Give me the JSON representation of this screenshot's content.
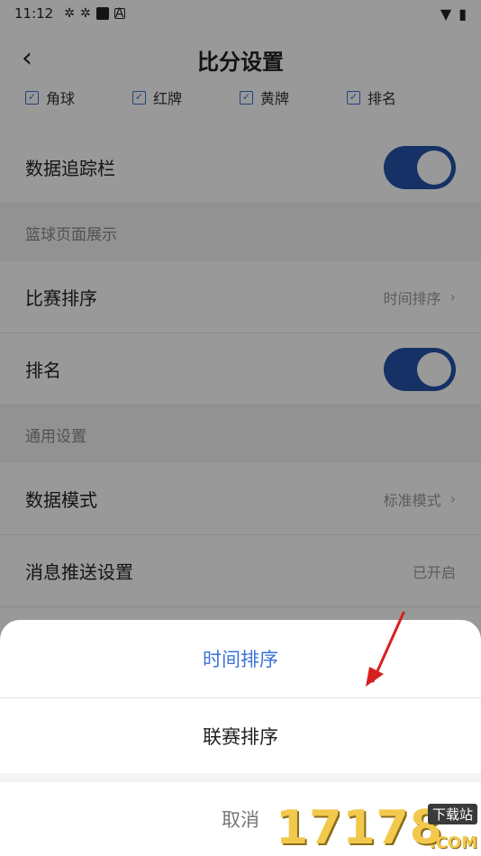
{
  "status_bar": {
    "time": "11:12"
  },
  "header": {
    "title": "比分设置",
    "back_icon": "chevron-left-icon"
  },
  "checkboxes": [
    {
      "label": "角球"
    },
    {
      "label": "红牌"
    },
    {
      "label": "黄牌"
    },
    {
      "label": "排名"
    }
  ],
  "rows": {
    "tracker": {
      "label": "数据追踪栏",
      "toggle": "on"
    },
    "basketball_section": "篮球页面展示",
    "match_sort": {
      "label": "比赛排序",
      "value": "时间排序"
    },
    "ranking": {
      "label": "排名",
      "toggle": "on"
    },
    "general_section": "通用设置",
    "data_mode": {
      "label": "数据模式",
      "value": "标准模式"
    },
    "push": {
      "label": "消息推送设置",
      "value": "已开启"
    }
  },
  "sheet": {
    "options": [
      {
        "label": "时间排序",
        "selected": true
      },
      {
        "label": "联赛排序",
        "selected": false
      }
    ],
    "cancel": "取消"
  },
  "watermark": {
    "text": "17178",
    "badge": "下载站",
    "suffix": ".COM"
  },
  "colors": {
    "accent": "#3b73d9",
    "toggle": "#2452a8",
    "annotation_arrow": "#d62020",
    "watermark": "#f2c94c"
  }
}
